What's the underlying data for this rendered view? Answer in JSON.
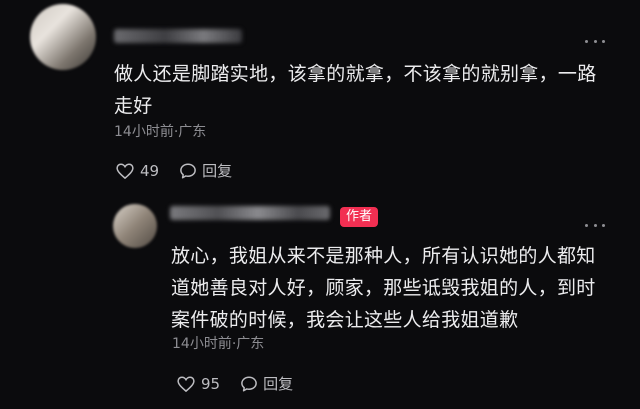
{
  "comments": [
    {
      "text": "做人还是脚踏实地，该拿的就拿，不该拿的就别拿，一路走好",
      "meta": "14小时前·广东",
      "likes": "49",
      "reply_label": "回复"
    },
    {
      "author_badge": "作者",
      "text": "放心，我姐从来不是那种人，所有认识她的人都知道她善良对人好，顾家，那些诋毁我姐的人，到时案件破的时候，我会让这些人给我姐道歉",
      "meta": "14小时前·广东",
      "likes": "95",
      "reply_label": "回复"
    }
  ],
  "colors": {
    "background": "#0b0b0d",
    "text": "#ececee",
    "meta": "#8d8d92",
    "author_badge": "#f22f52"
  },
  "icons": {
    "like": "heart-outline-icon",
    "reply": "speech-bubble-icon",
    "more": "more-dots-icon"
  }
}
